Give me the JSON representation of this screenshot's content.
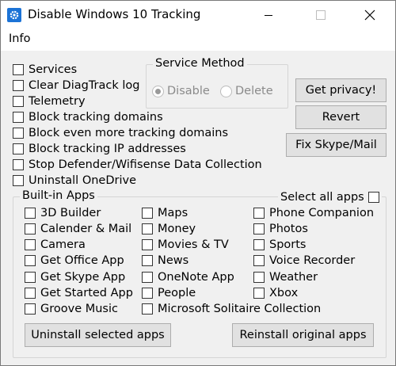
{
  "window": {
    "title": "Disable Windows 10 Tracking"
  },
  "menu": {
    "info": "Info"
  },
  "options": [
    "Services",
    "Clear DiagTrack log",
    "Telemetry",
    "Block tracking domains",
    "Block even more tracking domains",
    "Block tracking IP addresses",
    "Stop Defender/Wifisense Data Collection",
    "Uninstall OneDrive"
  ],
  "service_method": {
    "label": "Service Method",
    "disable": "Disable",
    "delete": "Delete",
    "selected": "Disable"
  },
  "buttons": {
    "get_privacy": "Get privacy!",
    "revert": "Revert",
    "fix_skype": "Fix Skype/Mail",
    "uninstall": "Uninstall selected apps",
    "reinstall": "Reinstall original apps"
  },
  "builtin": {
    "label": "Built-in Apps",
    "select_all": "Select all apps",
    "col1": [
      "3D Builder",
      "Calender & Mail",
      "Camera",
      "Get Office App",
      "Get Skype App",
      "Get Started App",
      "Groove Music"
    ],
    "col2": [
      "Maps",
      "Money",
      "Movies & TV",
      "News",
      "OneNote App",
      "People",
      "Microsoft Solitaire Collection"
    ],
    "col3": [
      "Phone Companion",
      "Photos",
      "Sports",
      "Voice Recorder",
      "Weather",
      "Xbox"
    ]
  },
  "colors": {
    "accent": "#1c73d6",
    "button_face": "#e1e1e1",
    "window_bg": "#f0f0f0"
  }
}
